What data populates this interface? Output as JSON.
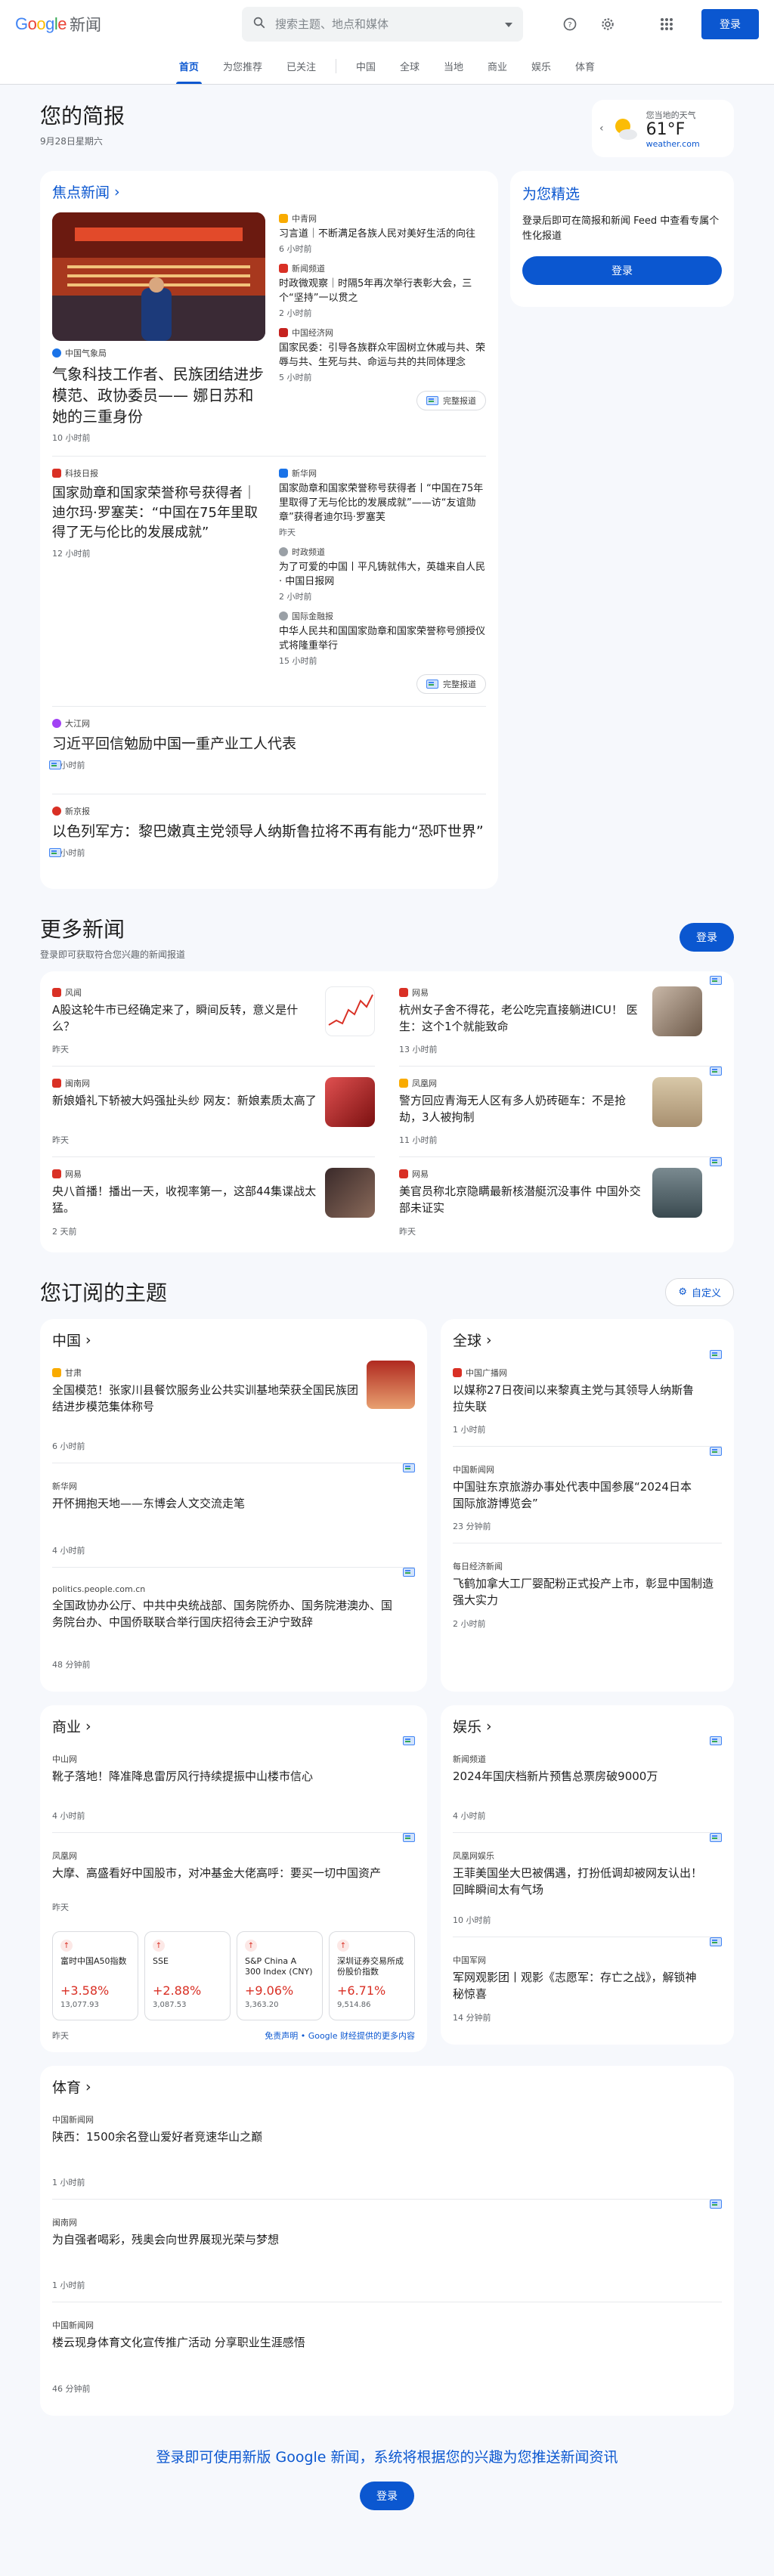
{
  "header": {
    "logo_google": "Google",
    "logo_news": "新闻",
    "search_placeholder": "搜索主题、地点和媒体",
    "signin": "登录"
  },
  "nav": {
    "tabs": [
      "首页",
      "为您推荐",
      "已关注"
    ],
    "sections": [
      "中国",
      "全球",
      "当地",
      "商业",
      "娱乐",
      "体育"
    ]
  },
  "briefing": {
    "title": "您的简报",
    "date": "9月28日星期六",
    "weather": {
      "label": "您当地的天气",
      "temp": "61°F",
      "source": "weather.com"
    }
  },
  "top_stories": {
    "label": "焦点新闻",
    "clusters": [
      {
        "main": {
          "source": "中国气象局",
          "title": "气象科技工作者、民族团结进步模范、政协委员—— 娜日苏和她的三重身份",
          "time": "10 小时前"
        },
        "subs": [
          {
            "source": "中青网",
            "title": "习言道｜不断满足各族人民对美好生活的向往",
            "time": "6 小时前"
          },
          {
            "source": "新闻频道",
            "title": "时政微观察｜时隔5年再次举行表彰大会，三个“坚持”一以贯之",
            "time": "2 小时前"
          },
          {
            "source": "中国经济网",
            "title": "国家民委：引导各族群众牢固树立休戚与共、荣辱与共、生死与共、命运与共的共同体理念",
            "time": "5 小时前"
          }
        ],
        "coverage": "完整报道"
      },
      {
        "main": {
          "source": "科技日报",
          "title": "国家勋章和国家荣誉称号获得者｜迪尔玛·罗塞芙：“中国在75年里取得了无与伦比的发展成就”",
          "time": "12 小时前"
        },
        "subs": [
          {
            "source": "新华网",
            "title": "国家勋章和国家荣誉称号获得者丨“中国在75年里取得了无与伦比的发展成就”——访“友谊勋章”获得者迪尔玛·罗塞芙",
            "time": "昨天"
          },
          {
            "source": "时政频道",
            "title": "为了可爱的中国丨平凡铸就伟大，英雄来自人民 · 中国日报网",
            "time": "2 小时前"
          },
          {
            "source": "国际金融报",
            "title": "中华人民共和国国家勋章和国家荣誉称号颁授仪式将隆重举行",
            "time": "15 小时前"
          }
        ],
        "coverage": "完整报道"
      }
    ],
    "singles": [
      {
        "source": "大江网",
        "title": "习近平回信勉励中国一重产业工人代表",
        "time": "5 小时前"
      },
      {
        "source": "新京报",
        "title": "以色列军方：黎巴嫩真主党领导人纳斯鲁拉将不再有能力“恐吓世界”",
        "time": "4 小时前"
      }
    ]
  },
  "picks": {
    "title": "为您精选",
    "text": "登录后即可在简报和新闻 Feed 中查看专属个性化报道",
    "button": "登录"
  },
  "more_news": {
    "title": "更多新闻",
    "subtitle": "登录即可获取符合您兴趣的新闻报道",
    "button": "登录",
    "items": [
      {
        "source": "风闻",
        "title": "A股这轮牛市已经确定来了，瞬间反转，意义是什么？",
        "time": "昨天"
      },
      {
        "source": "网易",
        "title": "杭州女子舍不得花，老公吃完直接躺进ICU！ 医生：这个1个就能致命",
        "time": "13 小时前"
      },
      {
        "source": "闽南网",
        "title": "新娘婚礼下轿被大妈强扯头纱 网友：新娘素质太高了",
        "time": "昨天"
      },
      {
        "source": "凤凰网",
        "title": "警方回应青海无人区有多人奶砖砸车：不是抢劫，3人被拘制",
        "time": "11 小时前"
      },
      {
        "source": "网易",
        "title": "央八首播！播出一天，收视率第一，这部44集谍战太猛。",
        "time": "2 天前"
      },
      {
        "source": "网易",
        "title": "美官员称北京隐瞒最新核潜艇沉没事件 中国外交部未证实",
        "time": "昨天"
      }
    ]
  },
  "topics": {
    "title": "您订阅的主题",
    "customize": "自定义",
    "china": {
      "title": "中国",
      "items": [
        {
          "source": "甘肃",
          "title": "全国模范！张家川县餐饮服务业公共实训基地荣获全国民族团结进步模范集体称号",
          "time": "6 小时前"
        },
        {
          "source": "新华网",
          "title": "开怀拥抱天地——东博会人文交流走笔",
          "time": "4 小时前"
        },
        {
          "source": "politics.people.com.cn",
          "title": "全国政协办公厅、中共中央统战部、国务院侨办、国务院港澳办、国务院台办、中国侨联联合举行国庆招待会王沪宁致辞",
          "time": "48 分钟前"
        }
      ]
    },
    "world": {
      "title": "全球",
      "items": [
        {
          "source": "中国广播网",
          "title": "以媒称27日夜间以来黎真主党与其领导人纳斯鲁拉失联",
          "time": "1 小时前"
        },
        {
          "source": "中国新闻网",
          "title": "中国驻东京旅游办事处代表中国参展“2024日本国际旅游博览会”",
          "time": "23 分钟前"
        },
        {
          "source": "每日经济新闻",
          "title": "飞鹤加拿大工厂婴配粉正式投产上市，彰显中国制造强大实力",
          "time": "2 小时前"
        }
      ]
    },
    "business": {
      "title": "商业",
      "items": [
        {
          "source": "中山网",
          "title": "靴子落地！降准降息雷厉风行持续提振中山楼市信心",
          "time": "4 小时前"
        },
        {
          "source": "凤凰网",
          "title": "大摩、高盛看好中国股市，对冲基金大佬高呼：要买一切中国资产",
          "time": "昨天"
        }
      ],
      "stocks": [
        {
          "name": "富时中国A50指数",
          "change": "+3.58%",
          "value": "13,077.93"
        },
        {
          "name": "SSE",
          "change": "+2.88%",
          "value": "3,087.53"
        },
        {
          "name": "S&P China A 300 Index (CNY)",
          "change": "+9.06%",
          "value": "3,363.20"
        },
        {
          "name": "深圳证券交易所成份股价指数",
          "change": "+6.71%",
          "value": "9,514.86"
        }
      ],
      "stocks_time": "昨天",
      "stocks_disclaimer": "免责声明 • Google 财经提供的更多内容"
    },
    "entertainment": {
      "title": "娱乐",
      "items": [
        {
          "source": "新闻频道",
          "title": "2024年国庆档新片预售总票房破9000万",
          "time": "4 小时前"
        },
        {
          "source": "凤凰网娱乐",
          "title": "王菲美国坐大巴被偶遇，打扮低调却被网友认出！ 回眸瞬间太有气场",
          "time": "10 小时前"
        },
        {
          "source": "中国军网",
          "title": "军网观影团丨观影《志愿军：存亡之战》，解锁神秘惊喜",
          "time": "14 分钟前"
        }
      ]
    },
    "sports": {
      "title": "体育",
      "items": [
        {
          "source": "中国新闻网",
          "title": "陕西：1500余名登山爱好者竞速华山之巅",
          "time": "1 小时前"
        },
        {
          "source": "闽南网",
          "title": "为自强者喝彩，残奥会向世界展现光荣与梦想",
          "time": "1 小时前"
        },
        {
          "source": "中国新闻网",
          "title": "楼云现身体育文化宣传推广活动 分享职业生涯感悟",
          "time": "46 分钟前"
        }
      ]
    }
  },
  "footer": {
    "cta": "登录即可使用新版 Google 新闻，系统将根据您的兴趣为您推送新闻资讯",
    "button": "登录"
  },
  "colors": {
    "accent": "#0b57d0",
    "stock_up": "#d93025"
  }
}
